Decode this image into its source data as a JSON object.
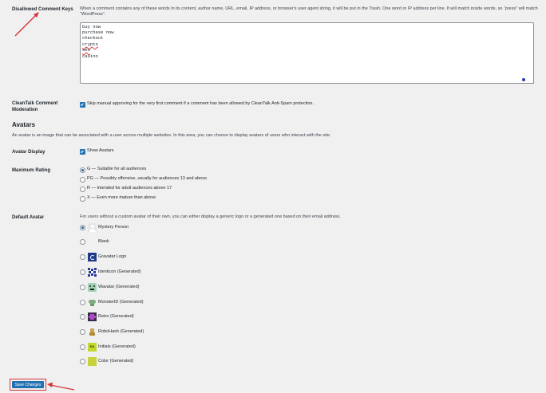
{
  "disallowed": {
    "label": "Disallowed Comment Keys",
    "desc": "When a comment contains any of these words in its content, author name, URL, email, IP address, or browser's user agent string, it will be put in the Trash. One word or IP address per line. It will match inside words, so “press” will match “WordPress”.",
    "keywords": [
      "buy now",
      "purchase now",
      "checkout",
      "crypto",
      "seo",
      "casino"
    ]
  },
  "cleantalk": {
    "label": "CleanTalk Comment Moderation",
    "checkbox_label": "Skip manual approving for the very first comment if a comment has been allowed by CleanTalk Anti-Spam protection.",
    "checked": true
  },
  "avatars": {
    "heading": "Avatars",
    "intro": "An avatar is an image that can be associated with a user across multiple websites. In this area, you can choose to display avatars of users who interact with the site.",
    "display_label": "Avatar Display",
    "display_checkbox": "Show Avatars",
    "display_checked": true
  },
  "rating": {
    "label": "Maximum Rating",
    "options": [
      {
        "text": "G — Suitable for all audiences",
        "selected": true
      },
      {
        "text": "PG — Possibly offensive, usually for audiences 13 and above",
        "selected": false
      },
      {
        "text": "R — Intended for adult audiences above 17",
        "selected": false
      },
      {
        "text": "X — Even more mature than above",
        "selected": false
      }
    ]
  },
  "default_avatar": {
    "label": "Default Avatar",
    "desc": "For users without a custom avatar of their own, you can either display a generic logo or a generated one based on their email address.",
    "options": [
      {
        "text": "Mystery Person",
        "icon": "mystery-person-icon",
        "selected": true
      },
      {
        "text": "Blank",
        "icon": "blank-icon",
        "selected": false
      },
      {
        "text": "Gravatar Logo",
        "icon": "gravatar-logo-icon",
        "selected": false
      },
      {
        "text": "Identicon (Generated)",
        "icon": "identicon-icon",
        "selected": false
      },
      {
        "text": "Wavatar (Generated)",
        "icon": "wavatar-icon",
        "selected": false
      },
      {
        "text": "MonsterID (Generated)",
        "icon": "monsterid-icon",
        "selected": false
      },
      {
        "text": "Retro (Generated)",
        "icon": "retro-icon",
        "selected": false
      },
      {
        "text": "RoboHash (Generated)",
        "icon": "robohash-icon",
        "selected": false
      },
      {
        "text": "Initials (Generated)",
        "icon": "initials-icon",
        "initials": "RA",
        "selected": false
      },
      {
        "text": "Color (Generated)",
        "icon": "color-icon",
        "selected": false
      }
    ]
  },
  "save_button": "Save Changes",
  "colors": {
    "accent": "#2271b1",
    "annotation": "#d63638",
    "initials_bg": "#c3d82a",
    "color_bg": "#c7d23a"
  }
}
